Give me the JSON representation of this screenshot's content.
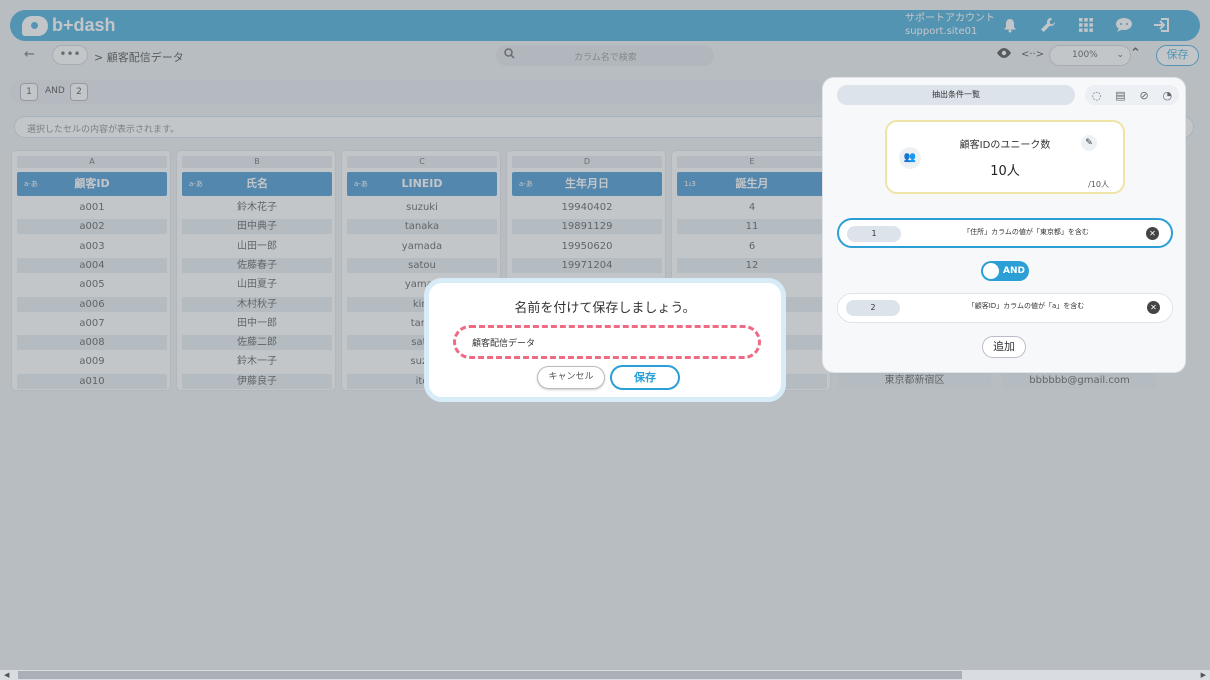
{
  "header": {
    "logo_text": "b+dash",
    "account_line1": "サポートアカウント",
    "account_line2": "support.site01",
    "icons": [
      "bell-icon",
      "wrench-icon",
      "apps-grid-icon",
      "chat-icon",
      "logout-icon"
    ]
  },
  "toolbar": {
    "back_label": "←",
    "more_label": "•••",
    "breadcrumb": "> 顧客配信データ",
    "search_placeholder": "カラム名で検索",
    "zoom": "100%",
    "save_label": "保存"
  },
  "filter": {
    "chip1": "1",
    "and_label": "AND",
    "chip2": "2"
  },
  "cell_view_placeholder": "選択したセルの内容が表示されます。",
  "table": {
    "columns": [
      {
        "letter": "A",
        "type": "a-あ",
        "header": "顧客ID",
        "cells": [
          "a001",
          "a002",
          "a003",
          "a004",
          "a005",
          "a006",
          "a007",
          "a008",
          "a009",
          "a010"
        ]
      },
      {
        "letter": "B",
        "type": "a-あ",
        "header": "氏名",
        "cells": [
          "鈴木花子",
          "田中典子",
          "山田一郎",
          "佐藤春子",
          "山田夏子",
          "木村秋子",
          "田中一郎",
          "佐藤二郎",
          "鈴木一子",
          "伊藤良子"
        ]
      },
      {
        "letter": "C",
        "type": "a-あ",
        "header": "LINEID",
        "cells": [
          "suzuki",
          "tanaka",
          "yamada",
          "satou",
          "yamad",
          "kim",
          "tana",
          "sato",
          "suzu",
          "ito"
        ]
      },
      {
        "letter": "D",
        "type": "a-あ",
        "header": "生年月日",
        "cells": [
          "19940402",
          "19891129",
          "19950620",
          "19971204",
          "",
          "",
          "",
          "",
          "",
          ""
        ]
      },
      {
        "letter": "E",
        "type": "1₂3",
        "header": "誕生月",
        "cells": [
          "4",
          "11",
          "6",
          "12",
          "",
          "",
          "",
          "",
          "",
          ""
        ]
      }
    ],
    "peek_cells": [
      "東京都新宿区",
      "bbbbbb@gmail.com"
    ]
  },
  "panel": {
    "title": "抽出条件一覧",
    "unique_label": "顧客IDのユニーク数",
    "unique_value": "10人",
    "unique_total": "/10人",
    "conditions": [
      {
        "num": "1",
        "text": "「住所」カラムの値が「東京都」を含む"
      },
      {
        "num": "2",
        "text": "「顧客ID」カラムの値が「a」を含む"
      }
    ],
    "and_label": "AND",
    "add_label": "追加"
  },
  "dialog": {
    "title": "名前を付けて保存しましょう。",
    "input_value": "顧客配信データ",
    "cancel_label": "キャンセル",
    "save_label": "保存"
  },
  "colors": {
    "brand": "#2b9fd6",
    "header_col": "#2b86cc",
    "highlight": "#ee6b83"
  }
}
